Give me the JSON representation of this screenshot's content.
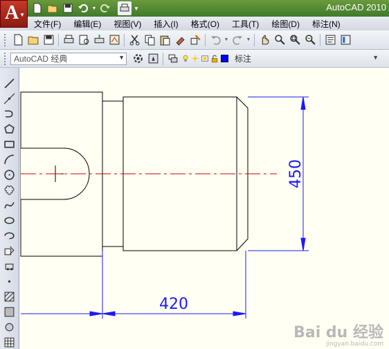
{
  "app": {
    "title": "AutoCAD 2010",
    "logo_letter": "A"
  },
  "menu": [
    "文件(F)",
    "编辑(E)",
    "视图(V)",
    "插入(I)",
    "格式(O)",
    "工具(T)",
    "绘图(D)",
    "标注(N)"
  ],
  "workspace": {
    "selected": "AutoCAD 经典"
  },
  "layer": {
    "current": "标注",
    "color": "#0000ff"
  },
  "drawing": {
    "dimensions": [
      {
        "name": "horizontal",
        "text": "420"
      },
      {
        "name": "vertical",
        "text": "450"
      }
    ]
  },
  "watermark": {
    "text": "Bai du 经验",
    "sub": "jingyan.baidu.com"
  },
  "colors": {
    "title_bar": "#4f8a2f",
    "canvas": "#fffff3",
    "geometry": "#000000",
    "centerline": "#cc0000",
    "dimension": "#0000ff"
  }
}
